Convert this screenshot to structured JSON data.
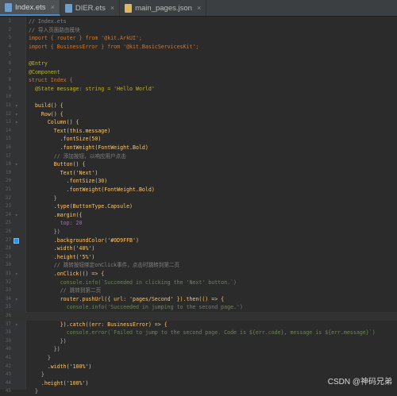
{
  "tabs": [
    {
      "label": "Index.ets",
      "active": true,
      "icon": "ets-file-icon"
    },
    {
      "label": "DIER.ets",
      "active": false,
      "icon": "ets-file-icon"
    },
    {
      "label": "main_pages.json",
      "active": false,
      "icon": "json-file-icon"
    }
  ],
  "code_lines": [
    {
      "n": "1",
      "text": "// Index.ets",
      "cls": "c"
    },
    {
      "n": "2",
      "text": "// 导入页面路由模块",
      "cls": "c"
    },
    {
      "n": "3",
      "text": "import { router } from '@kit.ArkUI';",
      "cls": "k"
    },
    {
      "n": "4",
      "text": "import { BusinessError } from '@kit.BasicServicesKit';",
      "cls": "k"
    },
    {
      "n": "5",
      "text": "",
      "cls": ""
    },
    {
      "n": "6",
      "text": "@Entry",
      "cls": "a"
    },
    {
      "n": "7",
      "text": "@Component",
      "cls": "a"
    },
    {
      "n": "8",
      "text": "struct Index {",
      "cls": "k"
    },
    {
      "n": "9",
      "text": "  @State message: string = 'Hello World'",
      "cls": "a"
    },
    {
      "n": "10",
      "text": "",
      "cls": ""
    },
    {
      "n": "11",
      "text": "  build() {",
      "cls": "f"
    },
    {
      "n": "12",
      "text": "    Row() {",
      "cls": "f"
    },
    {
      "n": "13",
      "text": "      Column() {",
      "cls": "f"
    },
    {
      "n": "14",
      "text": "        Text(this.message)",
      "cls": "f"
    },
    {
      "n": "15",
      "text": "          .fontSize(50)",
      "cls": "f"
    },
    {
      "n": "16",
      "text": "          .fontWeight(FontWeight.Bold)",
      "cls": "f"
    },
    {
      "n": "17",
      "text": "        // 添加按钮，以响应用户点击",
      "cls": "c"
    },
    {
      "n": "18",
      "text": "        Button() {",
      "cls": "f"
    },
    {
      "n": "19",
      "text": "          Text('Next')",
      "cls": "f"
    },
    {
      "n": "20",
      "text": "            .fontSize(30)",
      "cls": "f"
    },
    {
      "n": "21",
      "text": "            .fontWeight(FontWeight.Bold)",
      "cls": "f"
    },
    {
      "n": "22",
      "text": "        }",
      "cls": ""
    },
    {
      "n": "23",
      "text": "        .type(ButtonType.Capsule)",
      "cls": "f"
    },
    {
      "n": "24",
      "text": "        .margin({",
      "cls": "f"
    },
    {
      "n": "25",
      "text": "          top: 20",
      "cls": "p"
    },
    {
      "n": "26",
      "text": "        })",
      "cls": ""
    },
    {
      "n": "27",
      "text": "        .backgroundColor('#0D9FFB')",
      "cls": "f"
    },
    {
      "n": "28",
      "text": "        .width('40%')",
      "cls": "f"
    },
    {
      "n": "29",
      "text": "        .height('5%')",
      "cls": "f"
    },
    {
      "n": "30",
      "text": "        // 跳转按钮绑定onClick事件，点击时跳转到第二页",
      "cls": "c"
    },
    {
      "n": "31",
      "text": "        .onClick(() => {",
      "cls": "f"
    },
    {
      "n": "32",
      "text": "          console.info(`Succeeded in clicking the 'Next' button.`)",
      "cls": "s"
    },
    {
      "n": "33",
      "text": "          // 跳转到第二页",
      "cls": "c"
    },
    {
      "n": "34",
      "text": "          router.pushUrl({ url: 'pages/Second' }).then(() => {",
      "cls": "f"
    },
    {
      "n": "35",
      "text": "            console.info('Succeeded in jumping to the second page.')",
      "cls": "s"
    },
    {
      "n": "36",
      "text": "",
      "cls": ""
    },
    {
      "n": "37",
      "text": "          }).catch((err: BusinessError) => {",
      "cls": "f"
    },
    {
      "n": "38",
      "text": "            console.error(`Failed to jump to the second page. Code is ${err.code}, message is ${err.message}`)",
      "cls": "s"
    },
    {
      "n": "39",
      "text": "          })",
      "cls": ""
    },
    {
      "n": "40",
      "text": "        })",
      "cls": ""
    },
    {
      "n": "41",
      "text": "      }",
      "cls": ""
    },
    {
      "n": "42",
      "text": "      .width('100%')",
      "cls": "f"
    },
    {
      "n": "43",
      "text": "    }",
      "cls": ""
    },
    {
      "n": "44",
      "text": "    .height('100%')",
      "cls": "f"
    },
    {
      "n": "45",
      "text": "  }",
      "cls": ""
    }
  ],
  "swatch_color": "#0D9FFB",
  "watermark": "CSDN @神码兄弟"
}
